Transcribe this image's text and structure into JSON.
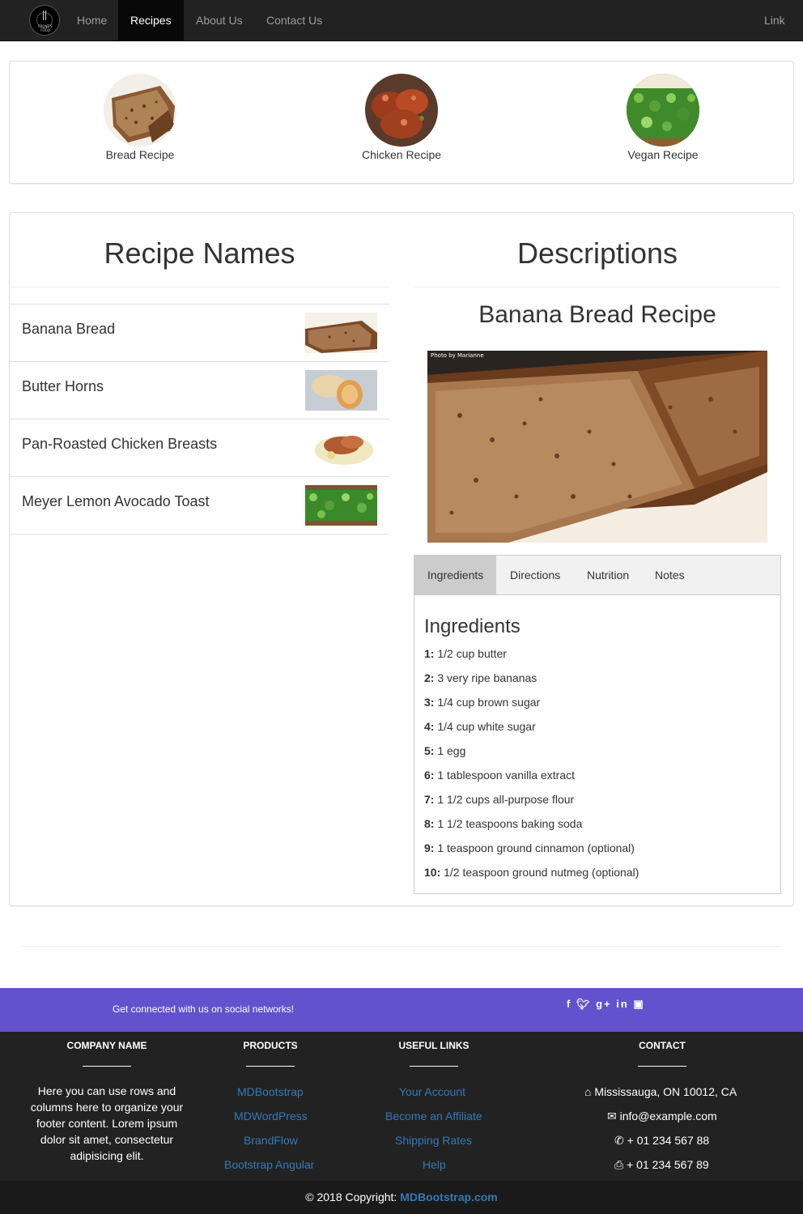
{
  "nav": {
    "brand_text": "FRONT'S FOOD",
    "items": [
      "Home",
      "Recipes",
      "About Us",
      "Contact Us"
    ],
    "active": "Recipes",
    "right_link": "Link"
  },
  "categories": [
    {
      "label": "Bread Recipe"
    },
    {
      "label": "Chicken Recipe"
    },
    {
      "label": "Vegan Recipe"
    }
  ],
  "main": {
    "left_heading": "Recipe Names",
    "right_heading": "Descriptions",
    "recipes": [
      {
        "name": "Banana Bread"
      },
      {
        "name": "Butter Horns"
      },
      {
        "name": "Pan-Roasted Chicken Breasts"
      },
      {
        "name": "Meyer Lemon Avocado Toast"
      }
    ],
    "selected_title": "Banana Bread Recipe",
    "photo_credit": "Photo by Marianne",
    "tabs": [
      "Ingredients",
      "Directions",
      "Nutrition",
      "Notes"
    ],
    "active_tab": "Ingredients",
    "ingredients_heading": "Ingredients",
    "ingredients": [
      {
        "n": "1:",
        "text": "1/2 cup butter"
      },
      {
        "n": "2:",
        "text": "3 very ripe bananas"
      },
      {
        "n": "3:",
        "text": "1/4 cup brown sugar"
      },
      {
        "n": "4:",
        "text": "1/4 cup white sugar"
      },
      {
        "n": "5:",
        "text": "1 egg"
      },
      {
        "n": "6:",
        "text": "1 tablespoon vanilla extract"
      },
      {
        "n": "7:",
        "text": "1 1/2 cups all-purpose flour"
      },
      {
        "n": "8:",
        "text": "1 1/2 teaspoons baking soda"
      },
      {
        "n": "9:",
        "text": "1 teaspoon ground cinnamon (optional)"
      },
      {
        "n": "10:",
        "text": "1/2 teaspoon ground nutmeg (optional)"
      }
    ]
  },
  "footer": {
    "social_text": "Get connected with us on social networks!",
    "social_icons": [
      "facebook-icon",
      "twitter-icon",
      "google-plus-icon",
      "linkedin-icon",
      "instagram-icon"
    ],
    "company": {
      "heading": "COMPANY NAME",
      "text": "Here you can use rows and columns here to organize your footer content. Lorem ipsum dolor sit amet, consectetur adipisicing elit."
    },
    "products": {
      "heading": "PRODUCTS",
      "links": [
        "MDBootstrap",
        "MDWordPress",
        "BrandFlow",
        "Bootstrap Angular"
      ]
    },
    "useful": {
      "heading": "USEFUL LINKS",
      "links": [
        "Your Account",
        "Become an Affiliate",
        "Shipping Rates",
        "Help"
      ]
    },
    "contact": {
      "heading": "CONTACT",
      "address": "Mississauga, ON 10012, CA",
      "email": "info@example.com",
      "phone": "+ 01 234 567 88",
      "fax": "+ 01 234 567 89"
    },
    "copyright": "© 2018 Copyright:",
    "copyright_link": "MDBootstrap.com"
  },
  "colors": {
    "navbar": "#222222",
    "social_bar": "#6351ce",
    "footer": "#222222",
    "link": "#337ab7"
  }
}
